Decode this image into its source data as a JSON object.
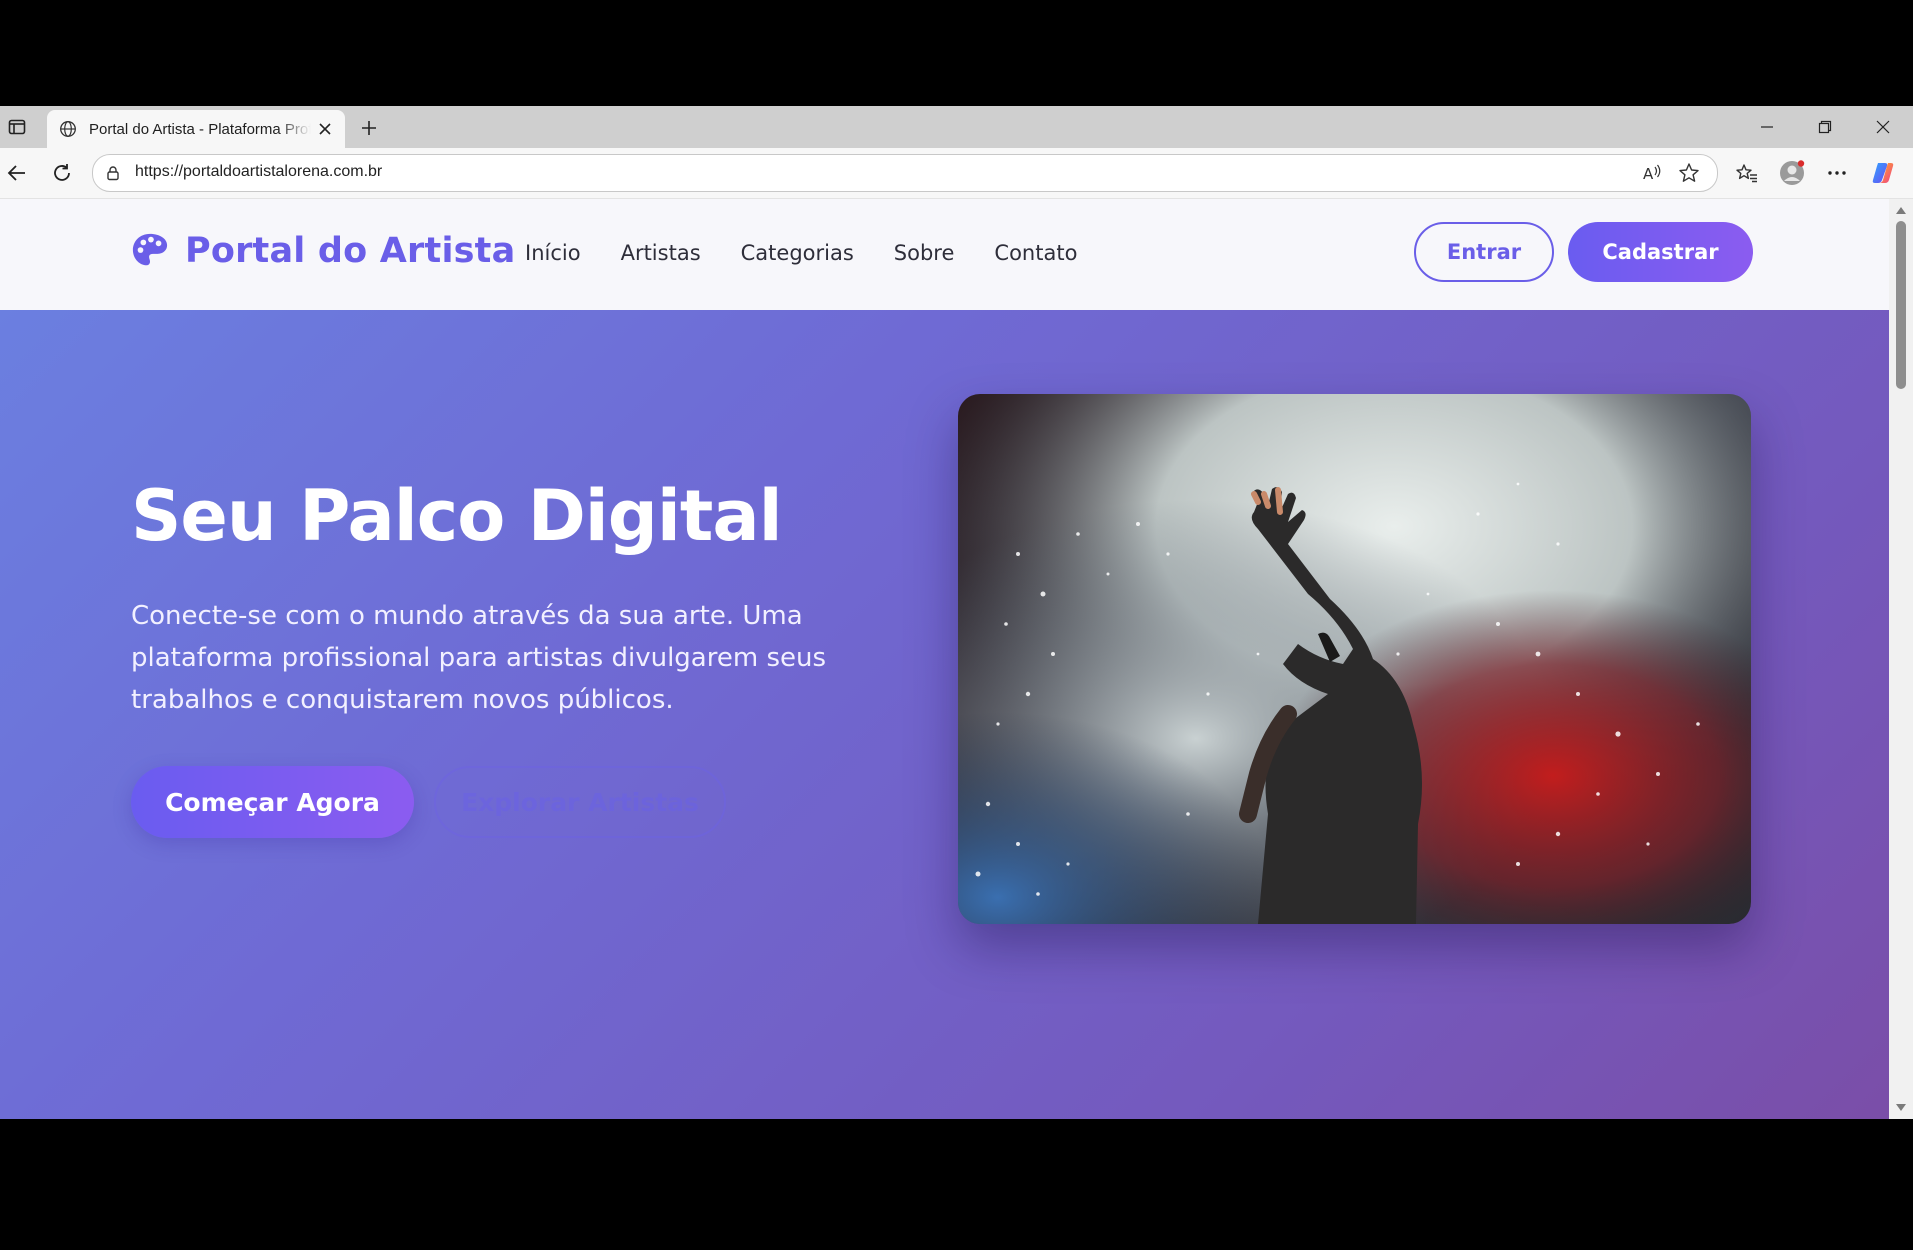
{
  "browser": {
    "tab_title": "Portal do Artista - Plataforma Profissional",
    "url": "https://portaldoartistalorena.com.br"
  },
  "site": {
    "brand": "Portal do Artista",
    "nav": {
      "inicio": "Início",
      "artistas": "Artistas",
      "categorias": "Categorias",
      "sobre": "Sobre",
      "contato": "Contato"
    },
    "login_label": "Entrar",
    "signup_label": "Cadastrar"
  },
  "hero": {
    "title": "Seu Palco Digital",
    "subtitle": "Conecte-se com o mundo através da sua arte. Uma plataforma profissional para artistas divulgarem seus trabalhos e conquistarem novos públicos.",
    "primary_cta": "Começar Agora",
    "secondary_cta": "Explorar Artistas"
  },
  "colors": {
    "brand": "#6a5ee8",
    "hero_gradient_start": "#6b7fe0",
    "hero_gradient_end": "#7a4ea8"
  }
}
